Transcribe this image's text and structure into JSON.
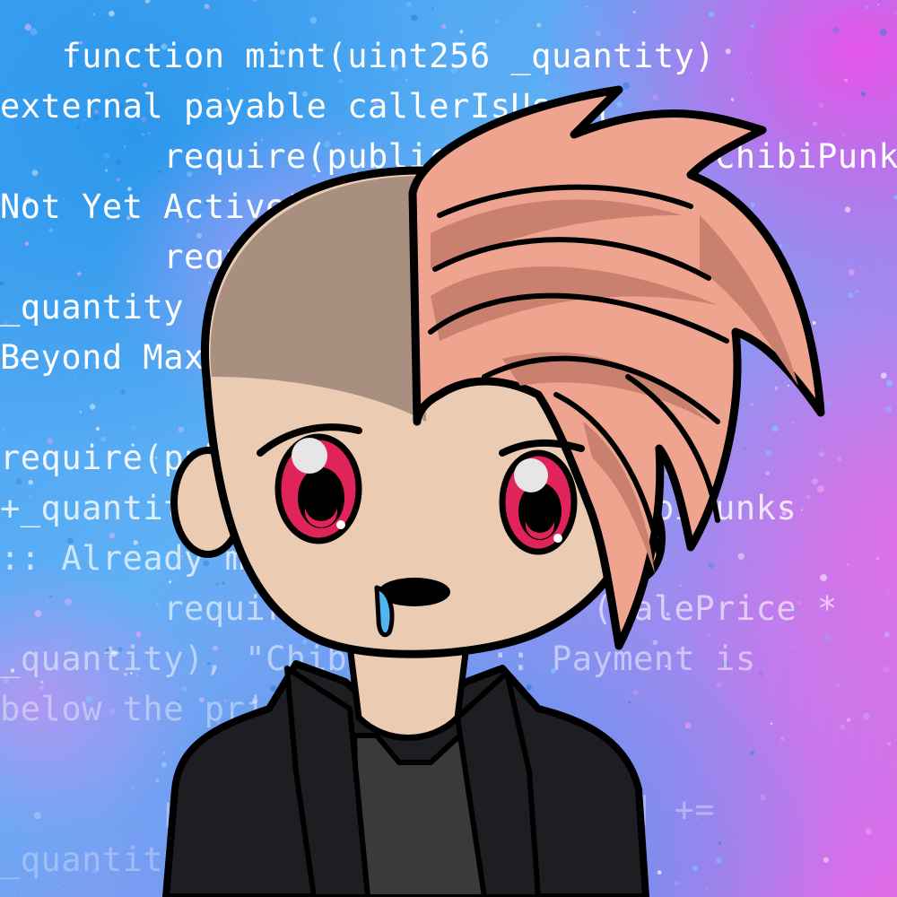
{
  "code_background": {
    "lines": [
      "   function mint(uint256 _quantity)",
      "external payable callerIsUser{",
      "        require(publicSaleActive, \"ChibiPunks",
      "Not Yet Active\");",
      "        require(totalSupply() +",
      "_quantity <= MaxTokens, \"ChibiPunks :",
      "Beyond Max Supply\");",
      "",
      "require(publicMinted[msg.sender]",
      "+_quantity <= maxPerWallet, \"ChibiPunks",
      ":: Already minted 3 times!\");",
      "        require(msg.value >= (SalePrice *",
      "_quantity), \"ChibiPunks :: Payment is",
      "below the price\");",
      "",
      "        publicMinted[msg.sender] +=",
      "_quantity;"
    ],
    "text_color": "#ffffff"
  },
  "character": {
    "skin_color": "#ebcbb2",
    "shaved_hair_color": "#a88f80",
    "hair_color": "#eea48e",
    "hair_shadow_color": "#c9806e",
    "eye_color": "#e0245a",
    "jacket_color": "#1e1e22",
    "shirt_color": "#3a3a3a",
    "outline_color": "#000000",
    "drool_color": "#4fb6f0"
  }
}
